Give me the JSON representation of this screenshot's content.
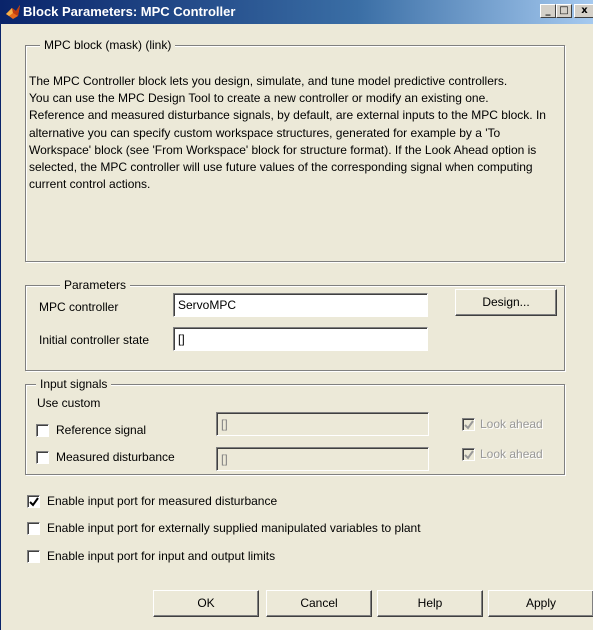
{
  "window": {
    "title": "Block Parameters: MPC Controller",
    "minimize_glyph": "_",
    "maximize_glyph": "□",
    "close_glyph": "x"
  },
  "mask_group": {
    "legend": "MPC block (mask) (link)",
    "description": [
      "The MPC Controller block lets you design, simulate, and tune model predictive controllers.",
      "You can use the MPC Design Tool to create a new controller or modify an existing one.",
      "Reference and measured disturbance signals, by default, are external inputs to the MPC block. In alternative you can specify custom workspace structures, generated for example by a 'To Workspace' block (see 'From Workspace' block for structure format). If the Look Ahead option is selected, the MPC controller will use future values of the corresponding signal when computing current control actions."
    ]
  },
  "parameters": {
    "legend": "Parameters",
    "mpc_controller_label": "MPC controller",
    "mpc_controller_value": "ServoMPC",
    "design_button": "Design...",
    "initial_state_label": "Initial controller state",
    "initial_state_value": "[]"
  },
  "input_signals": {
    "legend": "Input signals",
    "use_custom_label": "Use custom",
    "reference": {
      "label": "Reference signal",
      "checked": false,
      "value": "[]",
      "look_ahead": "Look ahead",
      "look_ahead_checked": true
    },
    "measured": {
      "label": "Measured disturbance",
      "checked": false,
      "value": "[]",
      "look_ahead": "Look ahead",
      "look_ahead_checked": true
    }
  },
  "options": [
    {
      "label": "Enable input port for measured disturbance",
      "checked": true
    },
    {
      "label": "Enable input port for externally supplied manipulated variables to plant",
      "checked": false
    },
    {
      "label": "Enable input port for input and output limits",
      "checked": false
    }
  ],
  "buttons": {
    "ok": "OK",
    "cancel": "Cancel",
    "help": "Help",
    "apply": "Apply"
  },
  "colors": {
    "titlebar_start": "#0a246a",
    "titlebar_end": "#a6caf0",
    "dialog_bg": "#ece9d8"
  }
}
